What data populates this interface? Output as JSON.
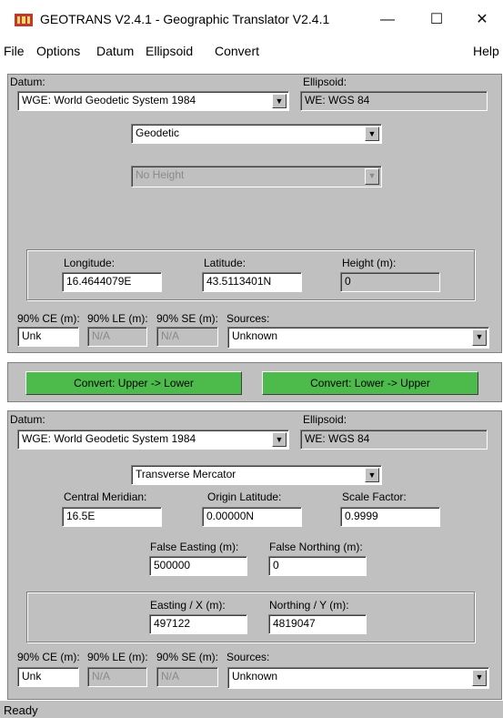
{
  "window": {
    "title": "GEOTRANS V2.4.1 - Geographic Translator V2.4.1",
    "minimize_glyph": "—",
    "maximize_glyph": "☐",
    "close_glyph": "✕"
  },
  "menu": {
    "file": "File",
    "options": "Options",
    "datum": "Datum",
    "ellipsoid": "Ellipsoid",
    "convert": "Convert",
    "help": "Help"
  },
  "upper": {
    "datum_label": "Datum:",
    "datum_value": "WGE:   World Geodetic System 1984",
    "ellipsoid_label": "Ellipsoid:",
    "ellipsoid_value": "WE: WGS 84",
    "projection_value": "Geodetic",
    "height_value": "No Height",
    "longitude_label": "Longitude:",
    "longitude_value": "16.4644079E",
    "latitude_label": "Latitude:",
    "latitude_value": "43.5113401N",
    "height_label": "Height (m):",
    "height_field": "0",
    "ce_label": "90% CE (m):",
    "le_label": "90% LE (m):",
    "se_label": "90% SE (m):",
    "sources_label": "Sources:",
    "ce_value": "Unk",
    "le_value": "N/A",
    "se_value": "N/A",
    "sources_value": "Unknown"
  },
  "buttons": {
    "upper_to_lower": "Convert: Upper -> Lower",
    "lower_to_upper": "Convert: Lower -> Upper"
  },
  "lower": {
    "datum_label": "Datum:",
    "datum_value": "WGE:   World Geodetic System 1984",
    "ellipsoid_label": "Ellipsoid:",
    "ellipsoid_value": "WE: WGS 84",
    "projection_value": "Transverse Mercator",
    "central_meridian_label": "Central Meridian:",
    "central_meridian_value": "16.5E",
    "origin_latitude_label": "Origin Latitude:",
    "origin_latitude_value": "0.00000N",
    "scale_factor_label": "Scale Factor:",
    "scale_factor_value": "0.9999",
    "false_easting_label": "False Easting (m):",
    "false_easting_value": "500000",
    "false_northing_label": "False Northing (m):",
    "false_northing_value": "0",
    "easting_label": "Easting / X (m):",
    "easting_value": "497122",
    "northing_label": "Northing / Y (m):",
    "northing_value": "4819047",
    "ce_label": "90% CE (m):",
    "le_label": "90% LE (m):",
    "se_label": "90% SE (m):",
    "sources_label": "Sources:",
    "ce_value": "Unk",
    "le_value": "N/A",
    "se_value": "N/A",
    "sources_value": "Unknown"
  },
  "status": {
    "text": "Ready"
  },
  "colors": {
    "panel": "#c0c0c0",
    "convert_button": "#4cbb4c"
  }
}
